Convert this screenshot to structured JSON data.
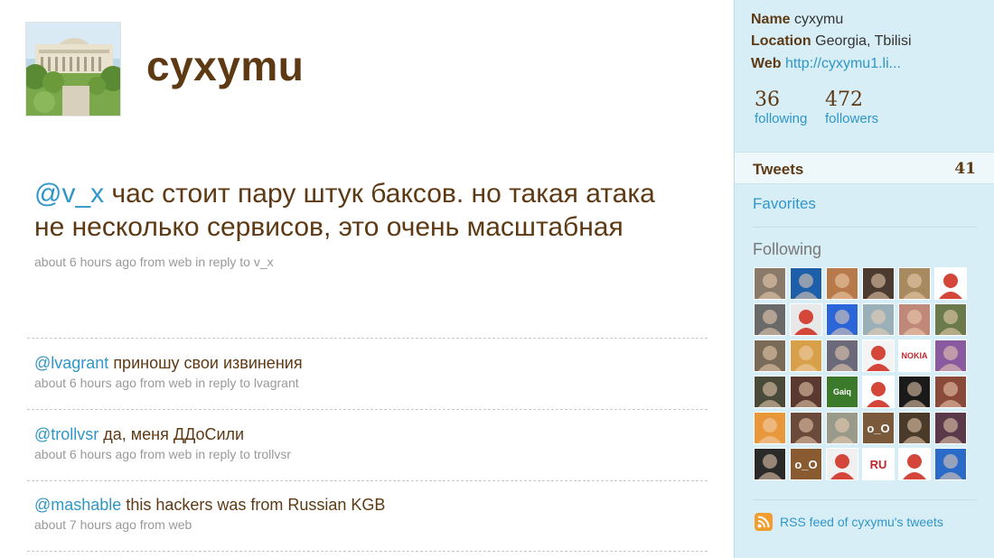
{
  "profile": {
    "username": "cyxymu",
    "name_label": "Name",
    "name_value": "cyxymu",
    "location_label": "Location",
    "location_value": "Georgia, Tbilisi",
    "web_label": "Web",
    "web_value": "http://cyxymu1.li..."
  },
  "stats": {
    "following_count": "36",
    "following_label": "following",
    "followers_count": "472",
    "followers_label": "followers"
  },
  "nav": {
    "tweets_label": "Tweets",
    "tweets_count": "41",
    "favorites_label": "Favorites",
    "following_title": "Following"
  },
  "main_tweet": {
    "mention": "@v_x",
    "text": " час стоит пару штук баксов. но такая атака не несколько сервисов, это очень масштабная",
    "meta_prefix": "about 6 hours ago from web in reply to ",
    "reply_to": "v_x"
  },
  "tweets": [
    {
      "mention": "@lvagrant",
      "text": " приношу свои извинения",
      "meta_prefix": "about 6 hours ago from web in reply to ",
      "reply_to": "lvagrant"
    },
    {
      "mention": "@trollvsr",
      "text": " да, меня ДДоСили",
      "meta_prefix": "about 6 hours ago from web in reply to ",
      "reply_to": "trollvsr"
    },
    {
      "mention": "@mashable",
      "text": " this hackers was from Russian KGB",
      "meta_prefix": "about 7 hours ago from web",
      "reply_to": ""
    }
  ],
  "following_avatars": [
    {
      "bg": "#8a7a6a",
      "label": ""
    },
    {
      "bg": "#1d5fa8",
      "label": ""
    },
    {
      "bg": "#b87a4a",
      "label": ""
    },
    {
      "bg": "#4a3a30",
      "label": ""
    },
    {
      "bg": "#a88a60",
      "label": ""
    },
    {
      "bg": "#ffffff",
      "label": ""
    },
    {
      "bg": "#6a6a6a",
      "label": ""
    },
    {
      "bg": "#e8e8e8",
      "label": ""
    },
    {
      "bg": "#2a66d8",
      "label": ""
    },
    {
      "bg": "#9ab0b8",
      "label": ""
    },
    {
      "bg": "#c08878",
      "label": ""
    },
    {
      "bg": "#6a7a4a",
      "label": ""
    },
    {
      "bg": "#7a6a58",
      "label": ""
    },
    {
      "bg": "#d8a048",
      "label": ""
    },
    {
      "bg": "#6a6a7a",
      "label": ""
    },
    {
      "bg": "#f4f4f4",
      "label": ""
    },
    {
      "bg": "#ffffff",
      "label": "NOKIA"
    },
    {
      "bg": "#8a5aa0",
      "label": ""
    },
    {
      "bg": "#4a4a3a",
      "label": ""
    },
    {
      "bg": "#5a3a30",
      "label": ""
    },
    {
      "bg": "#3a7a2a",
      "label": "Gaiq"
    },
    {
      "bg": "#ffffff",
      "label": ""
    },
    {
      "bg": "#1a1a1a",
      "label": ""
    },
    {
      "bg": "#8a4a3a",
      "label": ""
    },
    {
      "bg": "#e8983a",
      "label": ""
    },
    {
      "bg": "#6a4a3a",
      "label": ""
    },
    {
      "bg": "#9a9a8a",
      "label": ""
    },
    {
      "bg": "#7a5a3a",
      "label": "o_O"
    },
    {
      "bg": "#4a3a2a",
      "label": ""
    },
    {
      "bg": "#5a3a4a",
      "label": ""
    },
    {
      "bg": "#2a2a2a",
      "label": ""
    },
    {
      "bg": "#8a5a30",
      "label": "o_O"
    },
    {
      "bg": "#f0f0f0",
      "label": ""
    },
    {
      "bg": "#ffffff",
      "label": "RU"
    },
    {
      "bg": "#ffffff",
      "label": ""
    },
    {
      "bg": "#2a6ac8",
      "label": ""
    }
  ],
  "rss": {
    "label": "RSS feed of cyxymu's tweets"
  },
  "colors": {
    "sidebar_bg": "#d8eef6",
    "link": "#2f96c8",
    "text_brown": "#5e3a14",
    "meta_gray": "#999999"
  }
}
